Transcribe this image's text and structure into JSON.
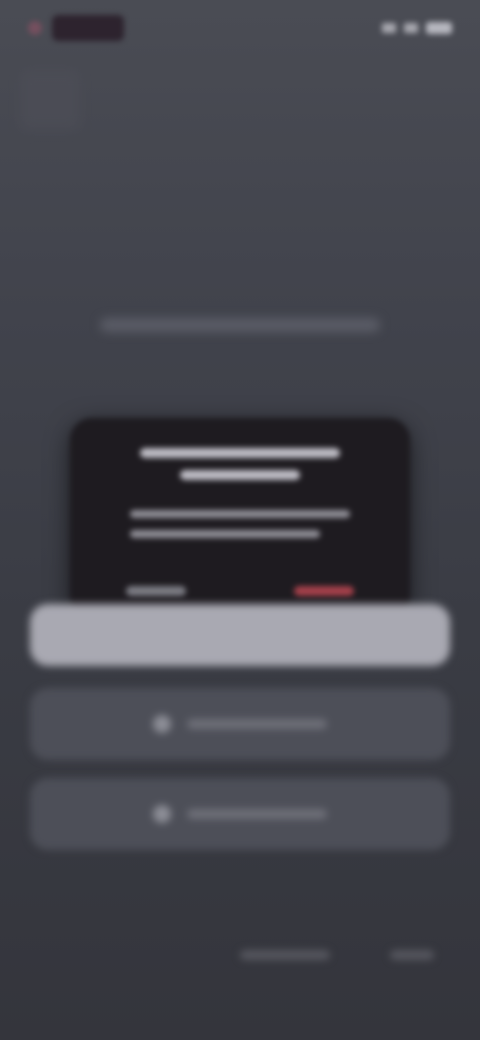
{
  "colors": {
    "background": "#41434c",
    "dialog_background": "#1e1b20",
    "accent": "#a4404a"
  },
  "icons": {
    "card_1": "generic-icon",
    "card_2": "generic-icon"
  }
}
